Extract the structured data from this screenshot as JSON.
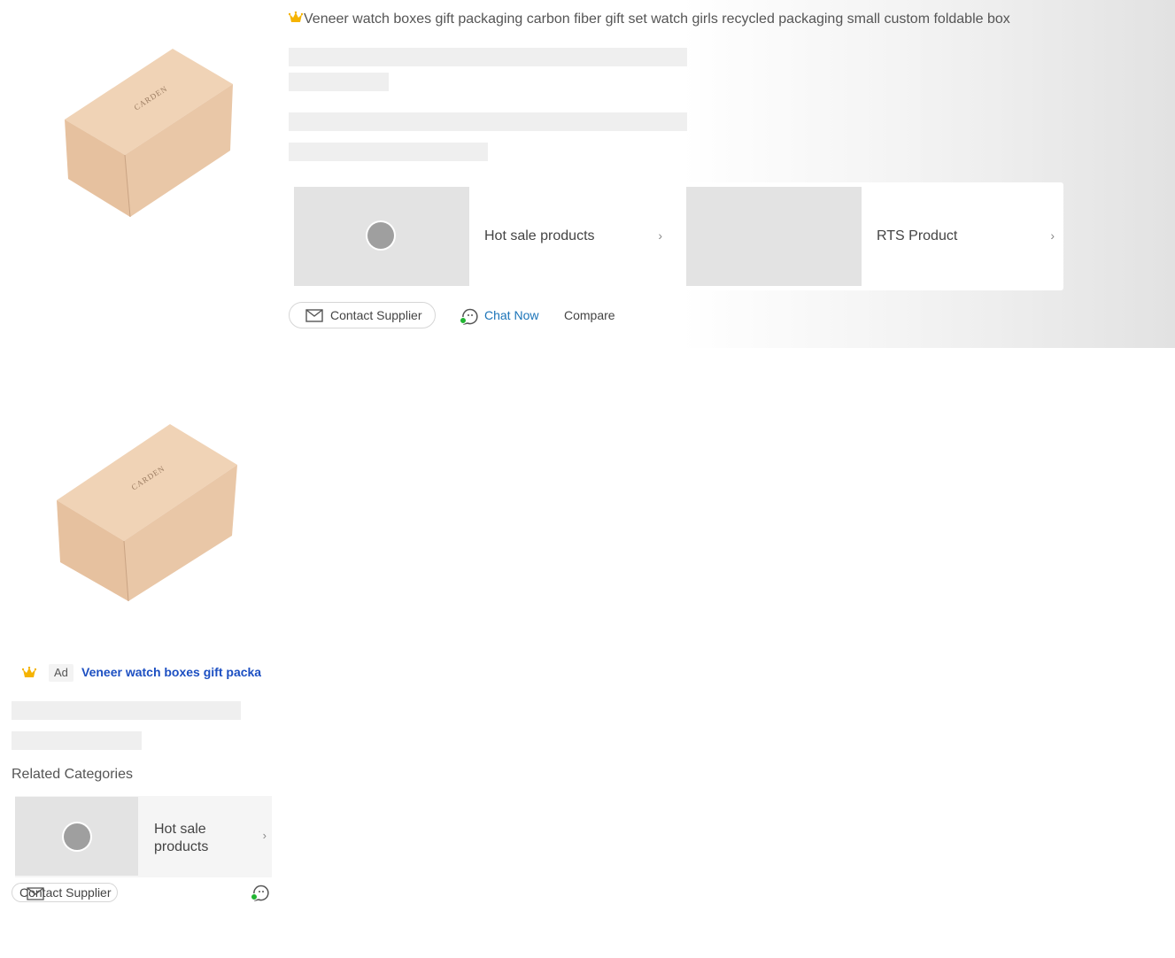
{
  "top_listing": {
    "title": "Veneer watch boxes gift packaging carbon fiber gift set watch girls recycled packaging small custom foldable box",
    "promos": [
      {
        "label": "Hot sale products",
        "chevron": "›"
      },
      {
        "label": "RTS Product",
        "chevron": "›"
      }
    ],
    "contact_label": "Contact Supplier",
    "chat_label": "Chat Now",
    "compare_label": "Compare",
    "product_image_text": "CARDEN"
  },
  "bottom_listing": {
    "ad_badge": "Ad",
    "title": "Veneer watch boxes gift packaging carbon fiber gift set watch girls recycled packaging small custom foldable box",
    "related_heading": "Related Categories",
    "promo": {
      "label": "Hot sale products",
      "chevron": "›"
    },
    "contact_label": "Contact Supplier",
    "product_image_text": "CARDEN"
  },
  "icons": {
    "crown": "crown-icon",
    "mail": "mail-icon",
    "chat": "chat-icon",
    "chevron": "chevron-right-icon",
    "online": "online-status-icon"
  },
  "colors": {
    "link_blue": "#1a73b8",
    "ad_title_blue": "#1c4fc2",
    "crown_gold": "#f5b301",
    "online_green": "#21b532",
    "box_kraft": "#e8c6a6"
  }
}
